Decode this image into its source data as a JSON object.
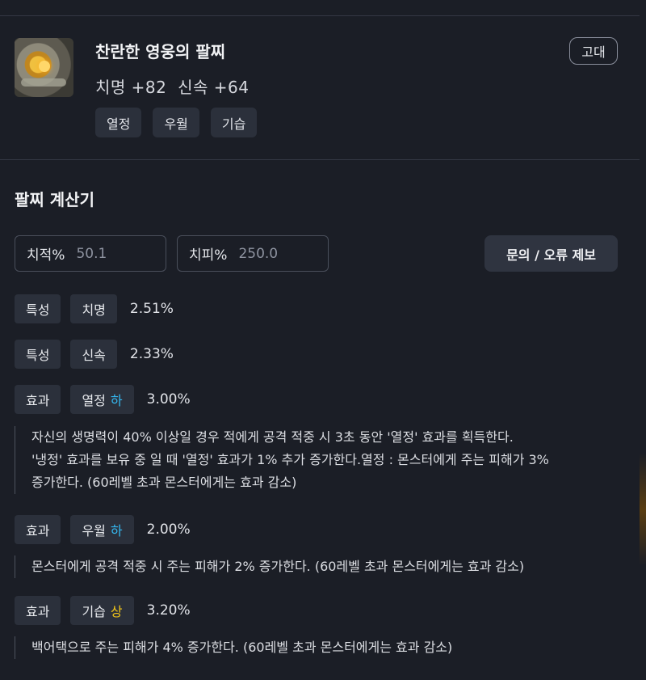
{
  "item": {
    "name": "찬란한 영웅의 팔찌",
    "stats": "치명 +82  신속 +64",
    "grade": "고대",
    "tags": [
      "열정",
      "우월",
      "기습"
    ]
  },
  "calculator": {
    "title": "팔찌 계산기",
    "crit_rate": {
      "label": "치적%",
      "value": "50.1"
    },
    "crit_damage": {
      "label": "치피%",
      "value": "250.0"
    },
    "report_button": "문의 / 오류 제보"
  },
  "rows": [
    {
      "type": "특성",
      "name": "치명",
      "grade": "",
      "value": "2.51%"
    },
    {
      "type": "특성",
      "name": "신속",
      "grade": "",
      "value": "2.33%"
    },
    {
      "type": "효과",
      "name": "열정",
      "grade": "하",
      "value": "3.00%",
      "desc_lines": [
        "자신의 생명력이 40% 이상일 경우 적에게 공격 적중 시 3초 동안 '열정' 효과를 획득한다.",
        "'냉정' 효과를 보유 중 일 때 '열정' 효과가 1% 추가 증가한다.열정 : 몬스터에게 주는 피해가 3%",
        "증가한다. (60레벨 초과 몬스터에게는 효과 감소)"
      ]
    },
    {
      "type": "효과",
      "name": "우월",
      "grade": "하",
      "value": "2.00%",
      "desc_lines": [
        "몬스터에게 공격 적중 시 주는 피해가 2% 증가한다. (60레벨 초과 몬스터에게는 효과 감소)"
      ]
    },
    {
      "type": "효과",
      "name": "기습",
      "grade": "상",
      "value": "3.20%",
      "desc_lines": [
        "백어택으로 주는 피해가 4% 증가한다. (60레벨 초과 몬스터에게는 효과 감소)"
      ]
    }
  ],
  "colors": {
    "background": "#1b1e26",
    "chip": "#2b303b",
    "grade_low": "#35b8f0",
    "grade_high": "#f0c419"
  }
}
